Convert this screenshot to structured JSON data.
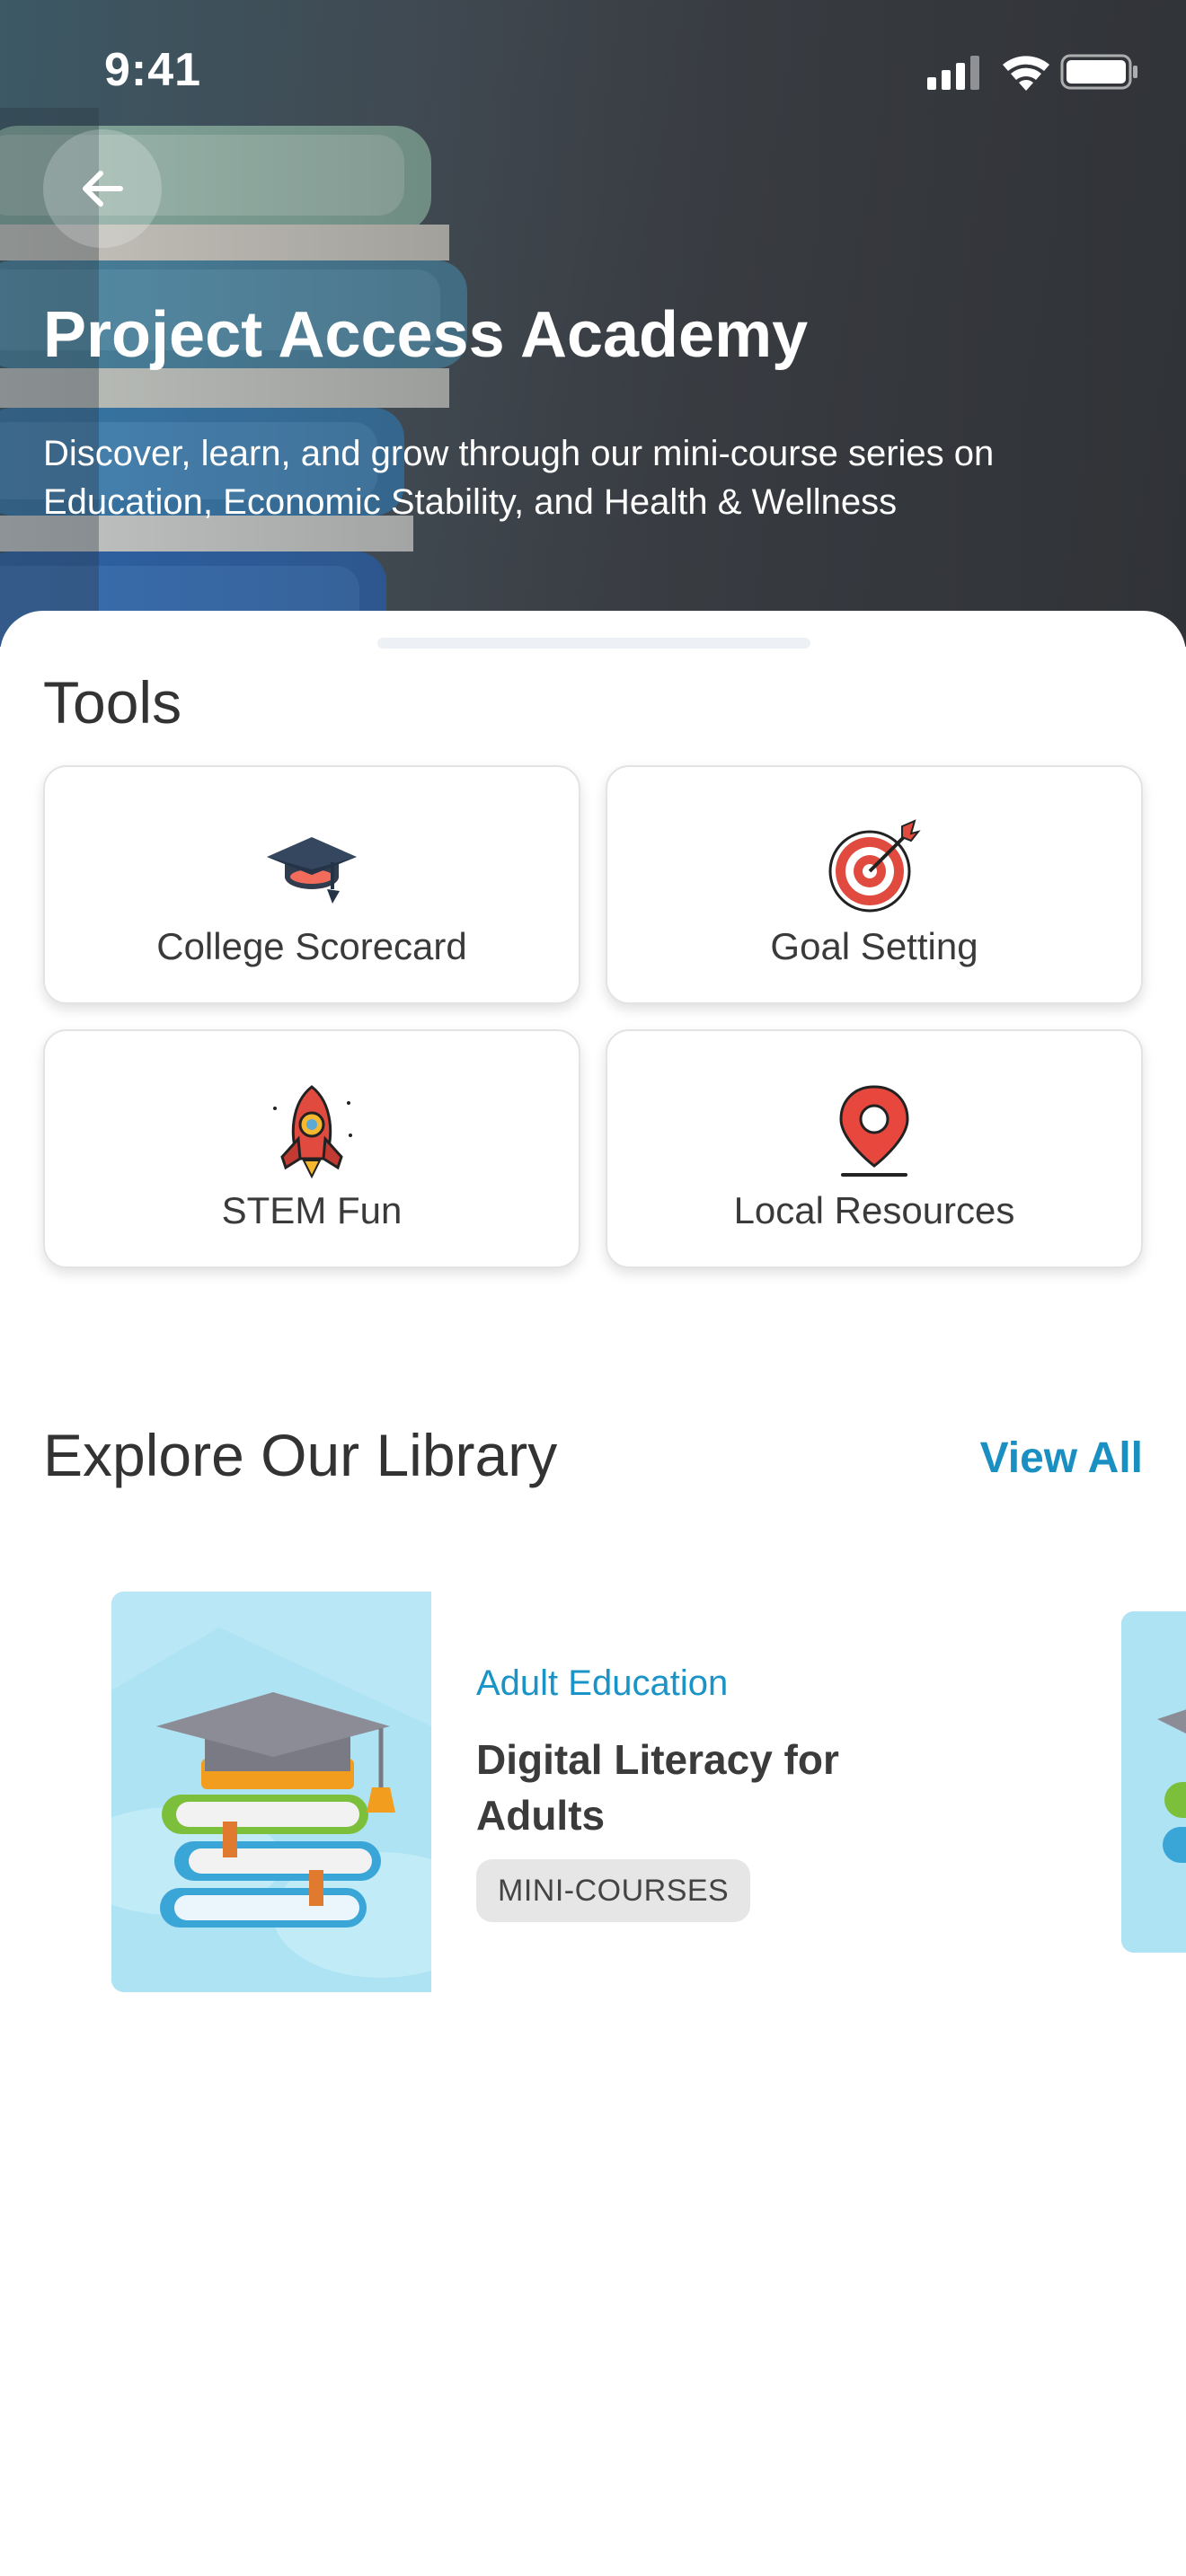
{
  "status_bar": {
    "time": "9:41",
    "icons": [
      "cellular-signal-icon",
      "wifi-icon",
      "battery-icon"
    ]
  },
  "hero": {
    "back_icon": "arrow-left-icon",
    "title": "Project Access Academy",
    "description": "Discover, learn, and grow through our mini-course series on Education, Economic Stability, and Health & Wellness"
  },
  "tools": {
    "title": "Tools",
    "items": [
      {
        "label": "College Scorecard",
        "icon": "graduation-cap-icon"
      },
      {
        "label": "Goal Setting",
        "icon": "target-arrow-icon"
      },
      {
        "label": "STEM Fun",
        "icon": "rocket-icon"
      },
      {
        "label": "Local Resources",
        "icon": "map-pin-icon"
      }
    ]
  },
  "library": {
    "title": "Explore Our Library",
    "view_all": "View All",
    "courses": [
      {
        "category": "Adult Education",
        "title": "Digital Literacy for Adults",
        "tag": "MINI-COURSES",
        "thumbnail_icon": "graduation-books-icon"
      }
    ]
  },
  "colors": {
    "accent": "#1a8fc2",
    "text_primary": "#333333",
    "tag_background": "#e6e6e6",
    "thumbnail_background": "#aee3f3"
  }
}
